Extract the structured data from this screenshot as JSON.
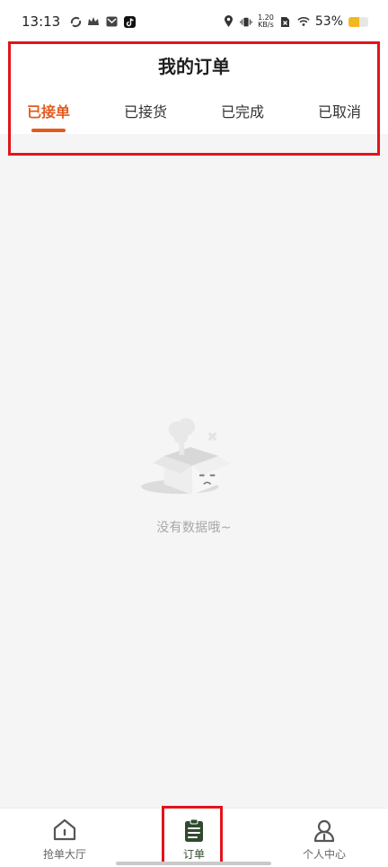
{
  "status_bar": {
    "time": "13:13",
    "network_speed_value": "1.20",
    "network_speed_unit": "KB/s",
    "battery_percent": "53%",
    "battery_level": 0.53
  },
  "header": {
    "title": "我的订单",
    "tabs": [
      {
        "label": "已接单",
        "active": true
      },
      {
        "label": "已接货",
        "active": false
      },
      {
        "label": "已完成",
        "active": false
      },
      {
        "label": "已取消",
        "active": false
      }
    ]
  },
  "empty_state": {
    "message": "没有数据哦~"
  },
  "bottom_nav": {
    "items": [
      {
        "label": "抢单大厅",
        "icon": "home-icon",
        "active": false
      },
      {
        "label": "订单",
        "icon": "clipboard-icon",
        "active": true
      },
      {
        "label": "个人中心",
        "icon": "person-icon",
        "active": false
      }
    ]
  },
  "colors": {
    "accent": "#e45b1f",
    "highlight": "#e2141c",
    "nav_active": "#2f4a2f"
  }
}
